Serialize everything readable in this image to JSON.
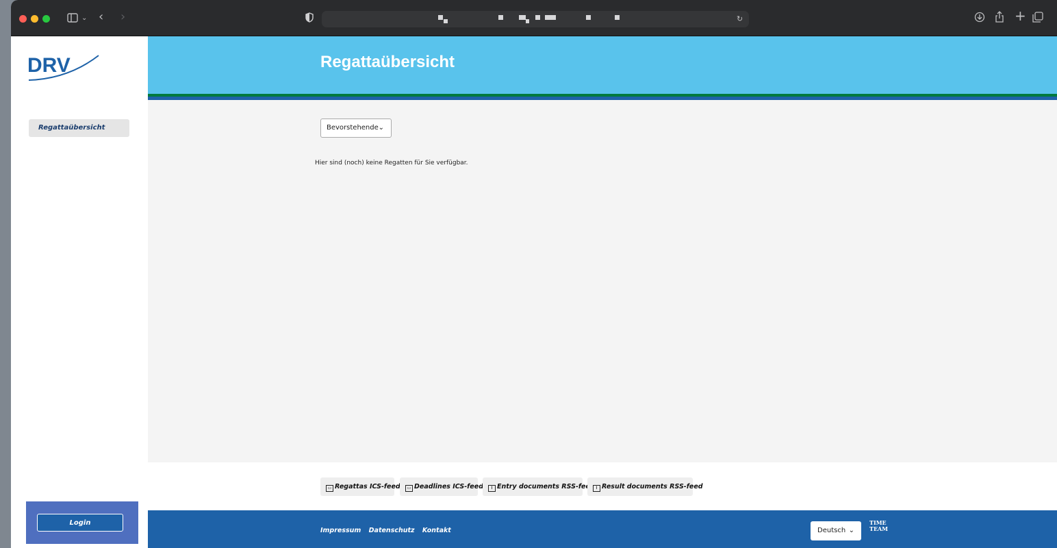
{
  "browser": {
    "icons": [
      "sidebar-icon",
      "chevron-down-icon",
      "back-icon",
      "forward-icon",
      "shield-icon",
      "reload-icon",
      "download-icon",
      "share-icon",
      "new-tab-icon",
      "tabs-icon"
    ]
  },
  "brand": {
    "logo_text": "DRV",
    "accent": "#59c3ec",
    "primary": "#1e62a8"
  },
  "sidebar": {
    "items": [
      {
        "label": "Regattaübersicht"
      }
    ],
    "login_label": "Login"
  },
  "header": {
    "title": "Regattaübersicht"
  },
  "main": {
    "filter": {
      "selected": "Bevorstehende"
    },
    "empty_message": "Hier sind (noch) keine Regatten für Sie verfügbar."
  },
  "feeds": [
    {
      "label": "Regattas ICS-feed",
      "icon": "calendar-icon"
    },
    {
      "label": "Deadlines ICS-feed",
      "icon": "calendar-icon"
    },
    {
      "label": "Entry documents RSS-feed",
      "icon": "rss-icon"
    },
    {
      "label": "Result documents RSS-feed",
      "icon": "rss-icon"
    }
  ],
  "footer": {
    "links": [
      "Impressum",
      "Datenschutz",
      "Kontakt"
    ],
    "language": "Deutsch",
    "partner_logo_line1": "TIME",
    "partner_logo_line2": "TEAM"
  }
}
